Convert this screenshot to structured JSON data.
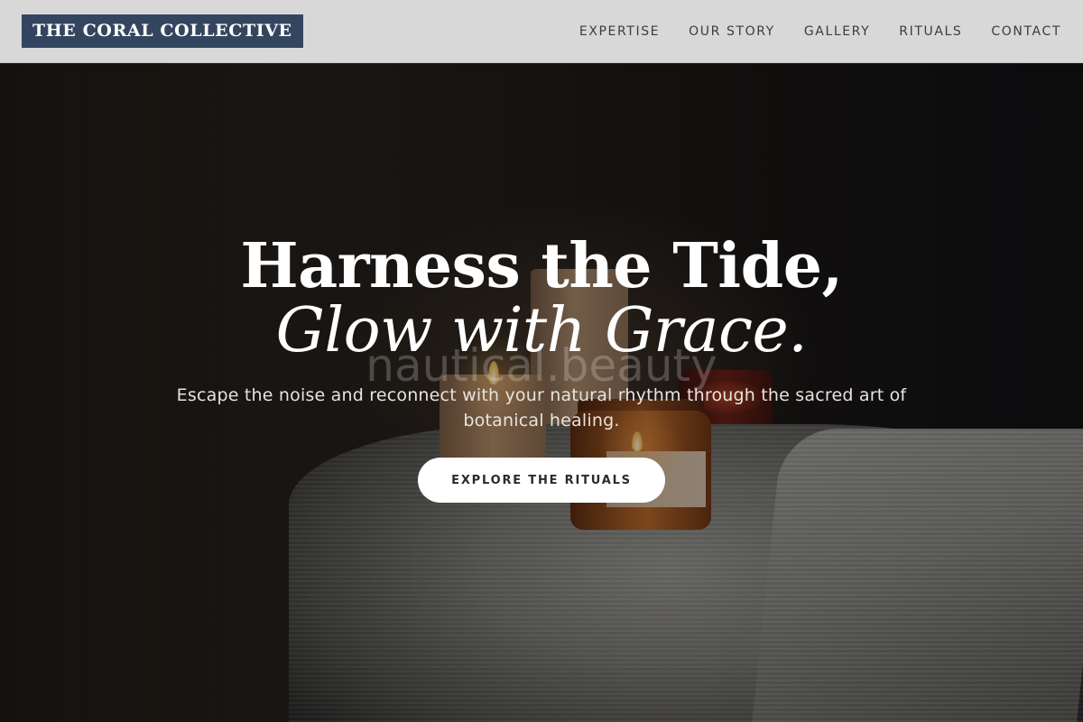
{
  "header": {
    "logo": "THE CORAL COLLECTIVE",
    "nav": [
      {
        "label": "EXPERTISE"
      },
      {
        "label": "OUR STORY"
      },
      {
        "label": "GALLERY"
      },
      {
        "label": "RITUALS"
      },
      {
        "label": "CONTACT"
      }
    ]
  },
  "hero": {
    "headline_line1": "Harness the Tide,",
    "headline_line2": "Glow with Grace.",
    "watermark": "nautical.beauty",
    "tagline": "Escape the noise and reconnect with your natural rhythm through the sacred art of botanical healing.",
    "cta_label": "EXPLORE THE RITUALS"
  },
  "colors": {
    "logo_bg": "#34465f",
    "header_bg": "#d9d8d8",
    "cta_bg": "#ffffff"
  }
}
